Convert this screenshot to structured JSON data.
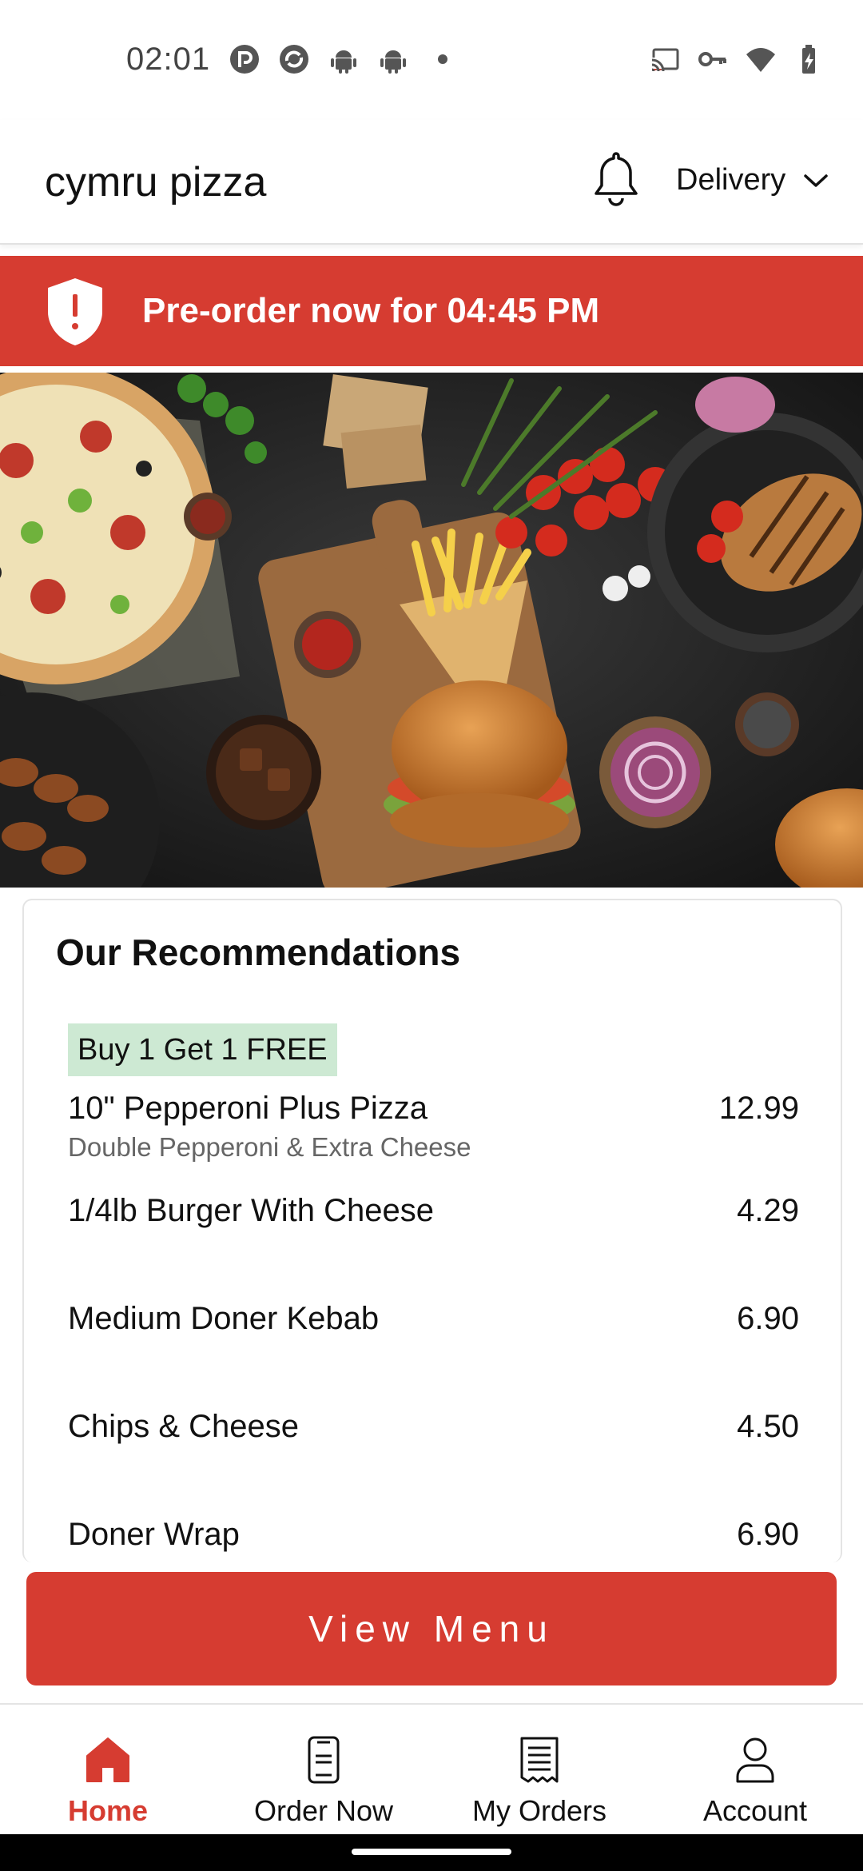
{
  "status_bar": {
    "time": "02:01",
    "left_icons": [
      "pocket-casts-icon",
      "sync-app-icon",
      "android-icon",
      "android-icon",
      "dot-icon"
    ],
    "right_icons": [
      "cast-icon",
      "vpn-key-icon",
      "wifi-icon",
      "battery-charging-icon"
    ]
  },
  "header": {
    "title": "cymru pizza",
    "notification_icon": "bell-icon",
    "mode_selector": "Delivery"
  },
  "banner": {
    "text": "Pre-order now for 04:45 PM",
    "icon": "shield-alert-icon",
    "color": "#d63c31"
  },
  "hero": {
    "image": "food-spread-photo"
  },
  "recommendations": {
    "title": "Our Recommendations",
    "items": [
      {
        "badge": "Buy 1 Get 1 FREE",
        "name": "10\" Pepperoni Plus Pizza",
        "description": "Double Pepperoni & Extra Cheese",
        "price": "12.99"
      },
      {
        "name": "1/4lb Burger With Cheese",
        "price": "4.29"
      },
      {
        "name": "Medium Doner Kebab",
        "price": "6.90"
      },
      {
        "name": "Chips & Cheese",
        "price": "4.50"
      },
      {
        "name": "Doner Wrap",
        "price": "6.90"
      }
    ]
  },
  "view_menu_label": "View Menu",
  "bottom_nav": {
    "items": [
      {
        "label": "Home",
        "icon": "home-icon",
        "active": true
      },
      {
        "label": "Order Now",
        "icon": "phone-order-icon",
        "active": false
      },
      {
        "label": "My Orders",
        "icon": "receipt-icon",
        "active": false
      },
      {
        "label": "Account",
        "icon": "person-icon",
        "active": false
      }
    ]
  },
  "colors": {
    "brand_red": "#d63c31",
    "badge_green": "#cde9d3"
  }
}
